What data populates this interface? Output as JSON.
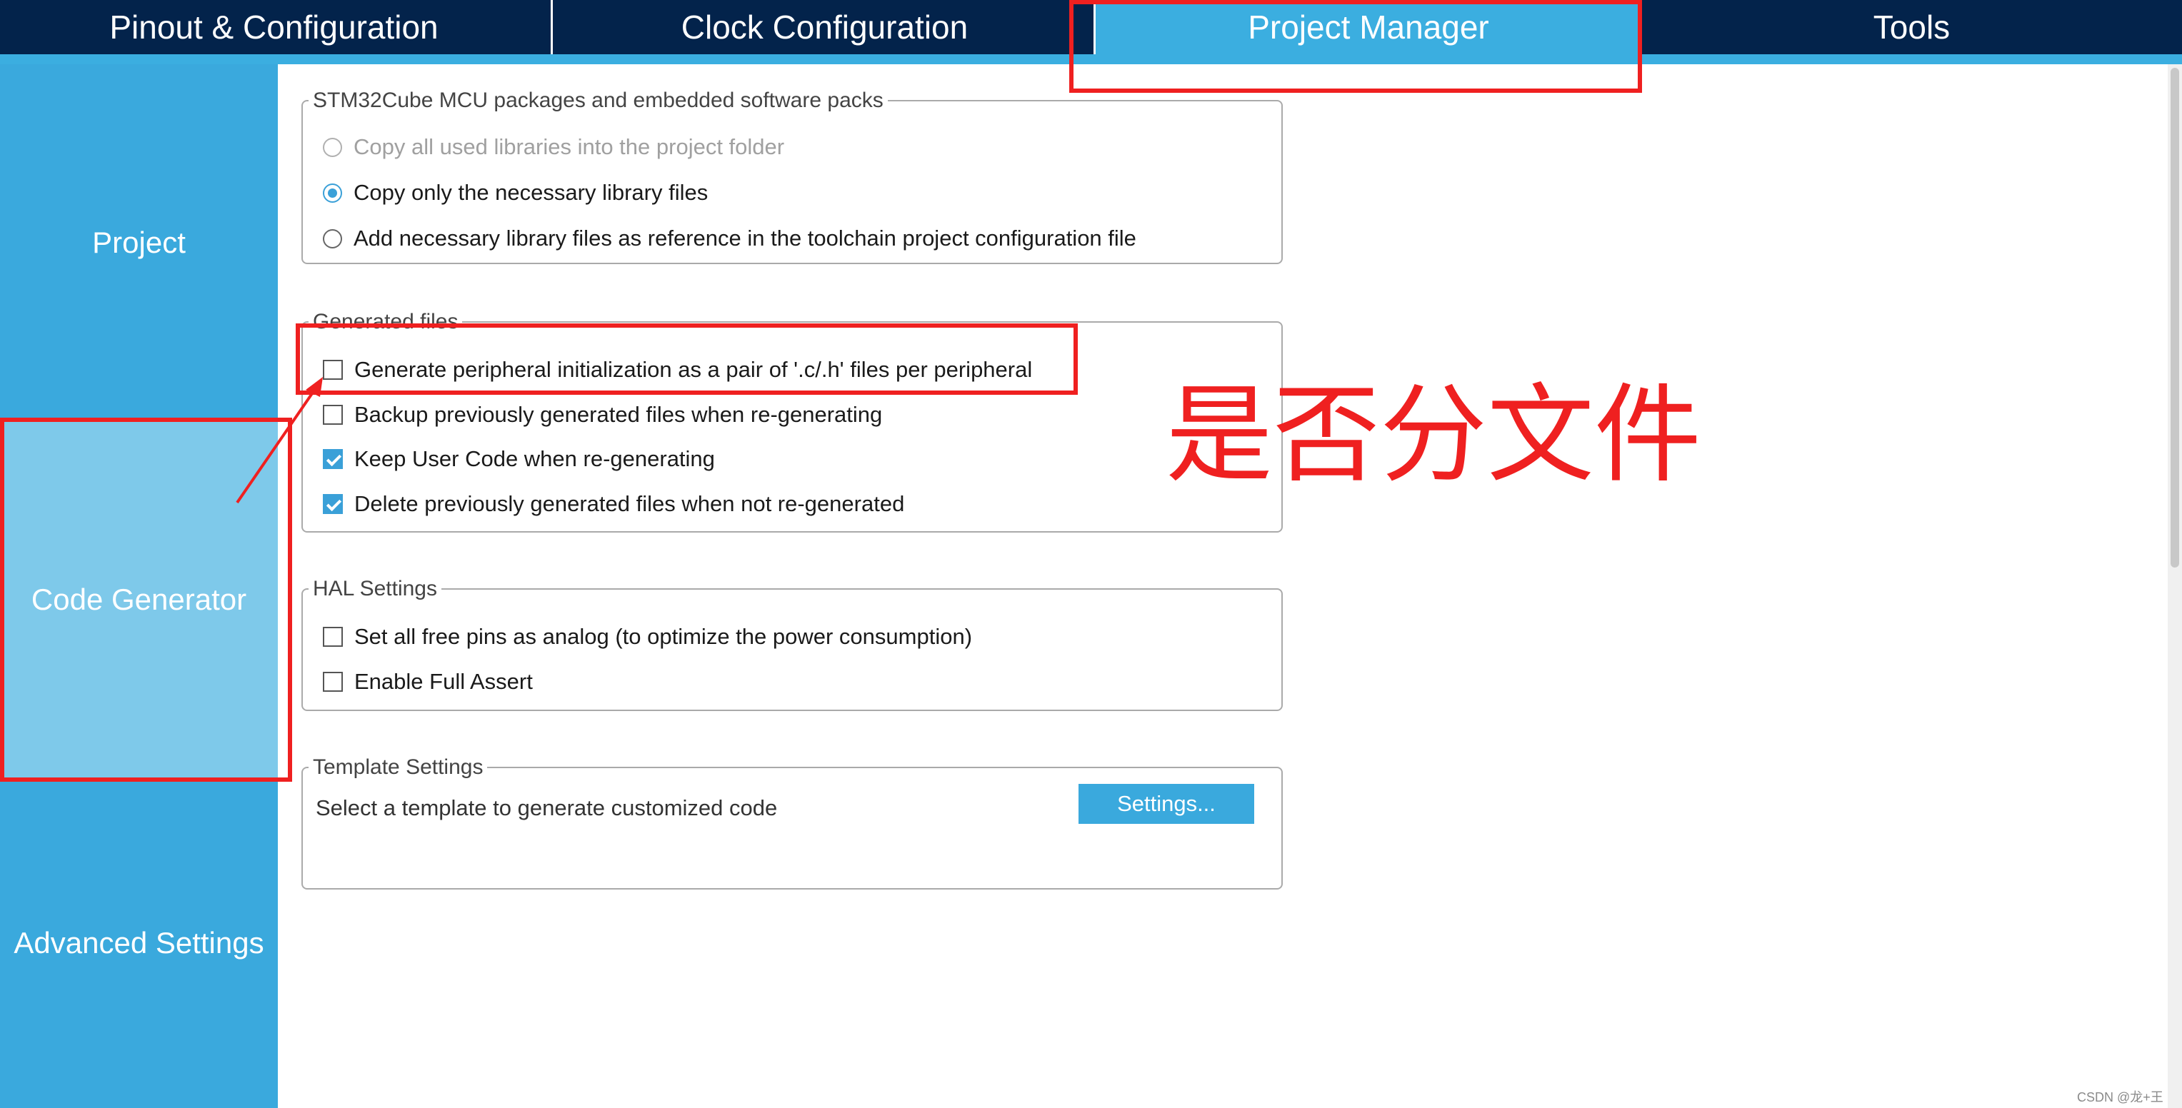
{
  "tabs": [
    {
      "label": "Pinout & Configuration"
    },
    {
      "label": "Clock Configuration"
    },
    {
      "label": "Project Manager"
    },
    {
      "label": "Tools"
    }
  ],
  "sidebar": {
    "items": [
      {
        "label": "Project"
      },
      {
        "label": "Code Generator"
      },
      {
        "label": "Advanced Settings"
      }
    ]
  },
  "mcu_packages": {
    "title": "STM32Cube MCU packages and embedded software packs",
    "options": [
      {
        "label": "Copy all used libraries into the project folder",
        "selected": false,
        "enabled": false
      },
      {
        "label": "Copy only the necessary library files",
        "selected": true,
        "enabled": true
      },
      {
        "label": "Add necessary library files as reference in the toolchain project configuration file",
        "selected": false,
        "enabled": true
      }
    ]
  },
  "generated_files": {
    "title": "Generated files",
    "options": [
      {
        "label": "Generate peripheral initialization as a pair of '.c/.h' files per peripheral",
        "checked": false
      },
      {
        "label": "Backup previously generated files when re-generating",
        "checked": false
      },
      {
        "label": "Keep User Code when re-generating",
        "checked": true
      },
      {
        "label": "Delete previously generated files when not re-generated",
        "checked": true
      }
    ]
  },
  "hal_settings": {
    "title": "HAL Settings",
    "options": [
      {
        "label": "Set all free pins as analog (to optimize the power consumption)",
        "checked": false
      },
      {
        "label": "Enable Full Assert",
        "checked": false
      }
    ]
  },
  "template_settings": {
    "title": "Template Settings",
    "description": "Select a template to generate customized code",
    "button_label": "Settings..."
  },
  "annotation": {
    "text": "是否分文件",
    "color": "#ef2020"
  },
  "watermark": "CSDN @龙+王",
  "colors": {
    "tabbar": "#03234b",
    "accent": "#3aa9dd",
    "sidebar_selected": "#7ec9ea"
  }
}
